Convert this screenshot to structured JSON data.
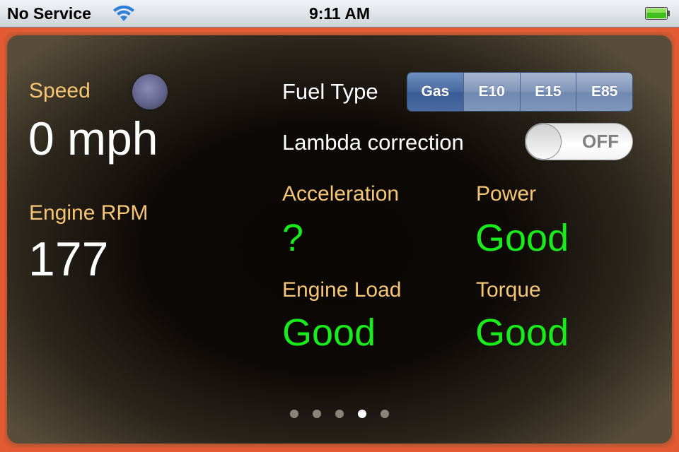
{
  "status_bar": {
    "carrier": "No Service",
    "time": "9:11 AM",
    "wifi_icon": "wifi-icon",
    "battery_icon": "battery-icon",
    "battery_level": 1.0
  },
  "colors": {
    "label": "#f5c574",
    "value_white": "#ffffff",
    "status_good": "#19ec1b",
    "frame_glow": "#e45a32",
    "segment_active": "#3a5c95"
  },
  "left_panel": {
    "speed": {
      "label": "Speed",
      "value": "0 mph"
    },
    "rpm": {
      "label": "Engine RPM",
      "value": "177"
    },
    "indicator_icon": "status-indicator-light"
  },
  "controls": {
    "fuel_type": {
      "label": "Fuel Type",
      "options": [
        "Gas",
        "E10",
        "E15",
        "E85"
      ],
      "selected": "Gas"
    },
    "lambda": {
      "label": "Lambda correction",
      "state": "OFF"
    }
  },
  "metrics": [
    {
      "label": "Acceleration",
      "value": "?"
    },
    {
      "label": "Power",
      "value": "Good"
    },
    {
      "label": "Engine Load",
      "value": "Good"
    },
    {
      "label": "Torque",
      "value": "Good"
    }
  ],
  "pager": {
    "total": 5,
    "current": 4
  }
}
